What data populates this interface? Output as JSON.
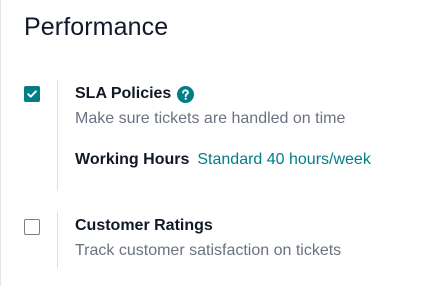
{
  "section": {
    "title": "Performance"
  },
  "settings": [
    {
      "label": "SLA Policies",
      "checked": true,
      "help_icon": "question-circle-icon",
      "description": "Make sure tickets are handled on time",
      "field": {
        "label": "Working Hours",
        "value": "Standard 40 hours/week"
      }
    },
    {
      "label": "Customer Ratings",
      "checked": false,
      "description": "Track customer satisfaction on tickets"
    }
  ],
  "colors": {
    "accent": "#017e84",
    "text": "#111827",
    "muted": "#6b7280"
  }
}
